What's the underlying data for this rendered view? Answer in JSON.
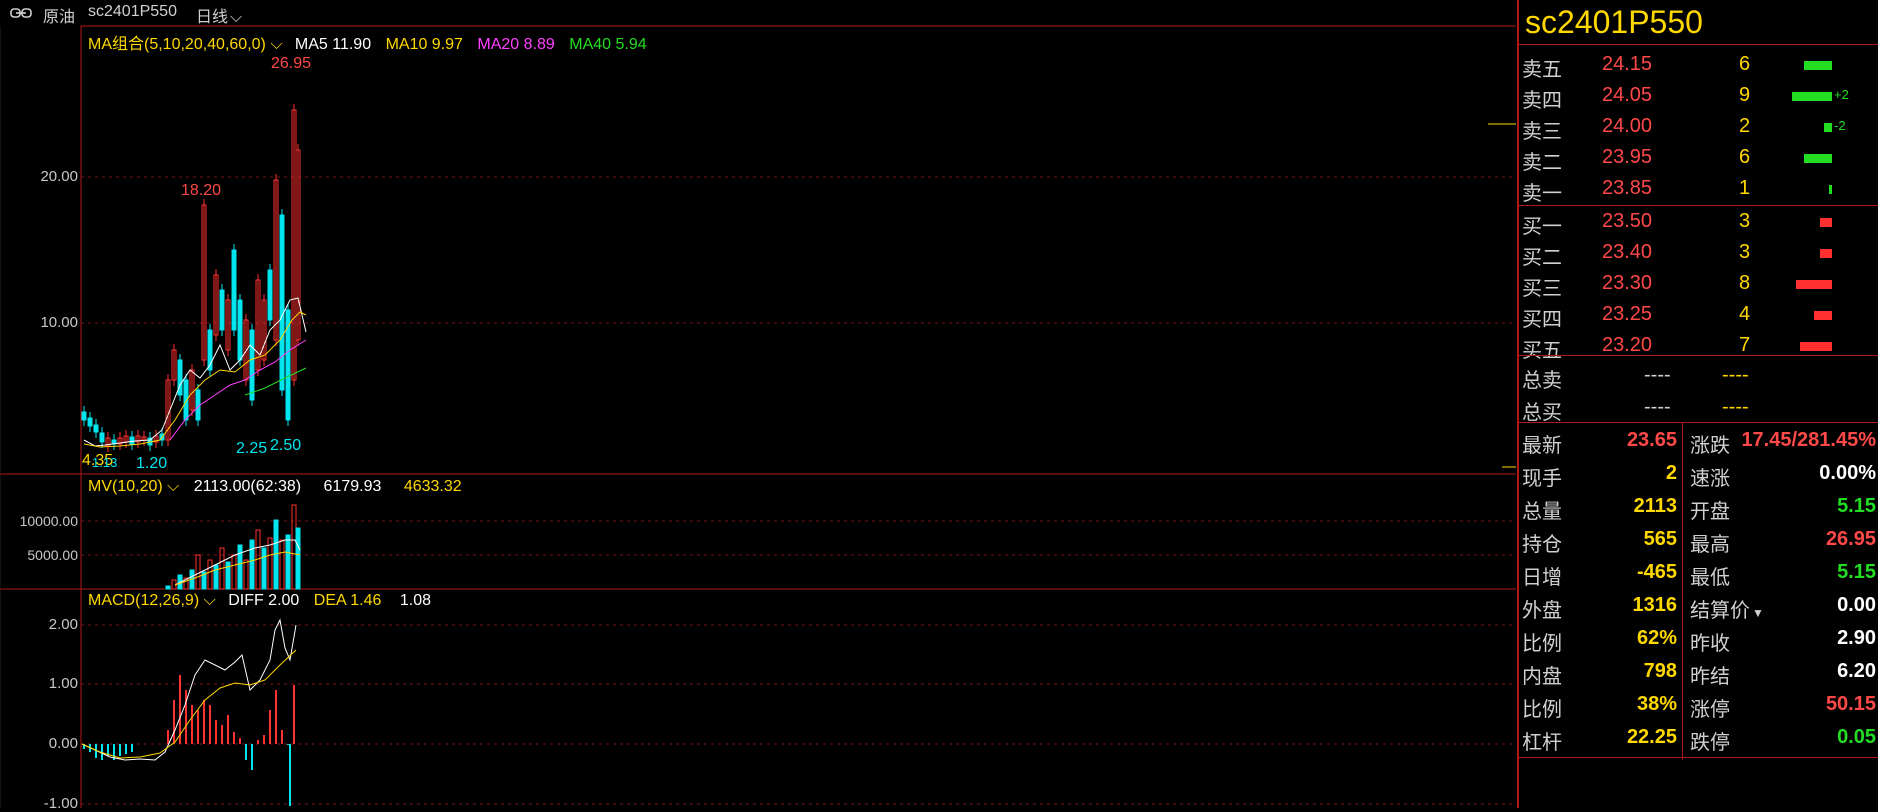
{
  "topbar": {
    "link_icon": "link-icon",
    "name": "原油",
    "code": "sc2401P550",
    "period": "日线"
  },
  "price_panel": {
    "legend_label": "MA组合(5,10,20,40,60,0)",
    "ma5": "MA5 11.90",
    "ma10": "MA10 9.97",
    "ma20": "MA20 8.89",
    "ma40": "MA40 5.94",
    "y_ticks": [
      "20.00",
      "10.00"
    ],
    "annotations": {
      "high": "26.95",
      "peak": "18.20",
      "low1": "1.20",
      "low2": "2.25",
      "low3": "2.50",
      "left": "4.35",
      "left2": "1.13"
    },
    "colors": {
      "ma5": "#ffffff",
      "ma10": "#ffd800",
      "ma20": "#ff40ff",
      "ma40": "#22dd22",
      "up": "#ff3030",
      "down": "#00e5ee"
    }
  },
  "volume_panel": {
    "legend_label": "MV(10,20)",
    "value1": "2113.00(62:38)",
    "value2": "6179.93",
    "value3": "4633.32",
    "y_ticks": [
      "10000.00",
      "5000.00"
    ]
  },
  "macd_panel": {
    "legend_label": "MACD(12,26,9)",
    "diff": "DIFF 2.00",
    "dea": "DEA 1.46",
    "macd": "1.08",
    "y_ticks": [
      "2.00",
      "1.00",
      "0.00",
      "-1.00"
    ]
  },
  "quote": {
    "title": "sc2401P550",
    "asks": [
      {
        "label": "卖五",
        "price": "24.15",
        "vol": "6",
        "change": ""
      },
      {
        "label": "卖四",
        "price": "24.05",
        "vol": "9",
        "change": "+2"
      },
      {
        "label": "卖三",
        "price": "24.00",
        "vol": "2",
        "change": "-2"
      },
      {
        "label": "卖二",
        "price": "23.95",
        "vol": "6",
        "change": ""
      },
      {
        "label": "卖一",
        "price": "23.85",
        "vol": "1",
        "change": ""
      }
    ],
    "bids": [
      {
        "label": "买一",
        "price": "23.50",
        "vol": "3"
      },
      {
        "label": "买二",
        "price": "23.40",
        "vol": "3"
      },
      {
        "label": "买三",
        "price": "23.30",
        "vol": "8"
      },
      {
        "label": "买四",
        "price": "23.25",
        "vol": "4"
      },
      {
        "label": "买五",
        "price": "23.20",
        "vol": "7"
      }
    ],
    "totals": [
      {
        "label": "总卖",
        "a": "----",
        "b": "----"
      },
      {
        "label": "总买",
        "a": "----",
        "b": "----"
      }
    ],
    "stats_left": [
      {
        "label": "最新",
        "value": "23.65",
        "color": "#ff4848"
      },
      {
        "label": "现手",
        "value": "2",
        "color": "#ffd800"
      },
      {
        "label": "总量",
        "value": "2113",
        "color": "#ffd800"
      },
      {
        "label": "持仓",
        "value": "565",
        "color": "#ffd800"
      },
      {
        "label": "日增",
        "value": "-465",
        "color": "#ffd800"
      },
      {
        "label": "外盘",
        "value": "1316",
        "color": "#ffd800"
      },
      {
        "label": "比例",
        "value": "62%",
        "color": "#ffd800"
      },
      {
        "label": "内盘",
        "value": "798",
        "color": "#ffd800"
      },
      {
        "label": "比例",
        "value": "38%",
        "color": "#ffd800"
      },
      {
        "label": "杠杆",
        "value": "22.25",
        "color": "#ffd800"
      }
    ],
    "stats_right": [
      {
        "label": "涨跌",
        "value": "17.45/281.45%",
        "color": "#ff4848"
      },
      {
        "label": "速涨",
        "value": "0.00%",
        "color": "#ffffff"
      },
      {
        "label": "开盘",
        "value": "5.15",
        "color": "#22dd22"
      },
      {
        "label": "最高",
        "value": "26.95",
        "color": "#ff4848"
      },
      {
        "label": "最低",
        "value": "5.15",
        "color": "#22dd22"
      },
      {
        "label": "结算价",
        "value": "0.00",
        "color": "#ffffff"
      },
      {
        "label": "昨收",
        "value": "2.90",
        "color": "#ffffff"
      },
      {
        "label": "昨结",
        "value": "6.20",
        "color": "#ffffff"
      },
      {
        "label": "涨停",
        "value": "50.15",
        "color": "#ff4848"
      },
      {
        "label": "跌停",
        "value": "0.05",
        "color": "#22dd22"
      }
    ]
  }
}
